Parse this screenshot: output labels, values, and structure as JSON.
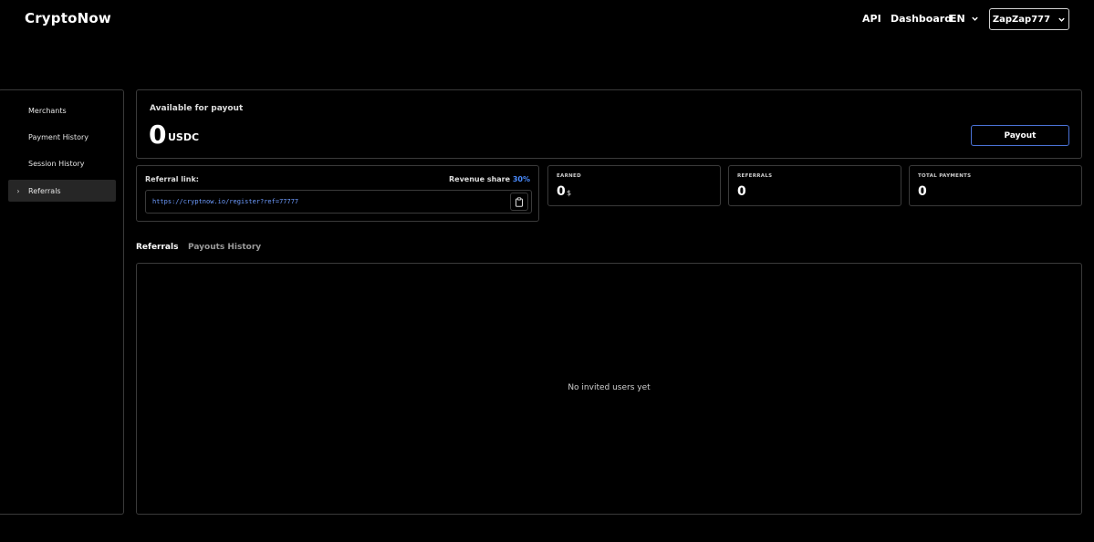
{
  "header": {
    "logo": "CryptoNow",
    "nav_api": "API",
    "nav_dashboard": "Dashboard",
    "lang": "EN",
    "user": "ZapZap777"
  },
  "sidebar": {
    "items": [
      {
        "label": "Merchants"
      },
      {
        "label": "Payment History"
      },
      {
        "label": "Session History"
      },
      {
        "label": "Referrals",
        "active": true
      }
    ]
  },
  "payout": {
    "label": "Available for payout",
    "amount": "0",
    "currency": "USDC",
    "button": "Payout"
  },
  "referral": {
    "label": "Referral link:",
    "revenue_label": "Revenue share",
    "revenue_value": "30%",
    "link": "https://cryptnow.io/register?ref=77777"
  },
  "stats": {
    "earned": {
      "label": "EARNED",
      "value": "0",
      "unit": "$"
    },
    "referrals": {
      "label": "REFERRALS",
      "value": "0"
    },
    "total_payments": {
      "label": "TOTAL PAYMENTS",
      "value": "0"
    }
  },
  "tabs": {
    "referrals": "Referrals",
    "payouts_history": "Payouts History"
  },
  "list": {
    "empty_text": "No invited users yet"
  },
  "colors": {
    "accent": "#4a8cff",
    "button_border": "#4a72d6",
    "card_border": "#3a3a3a"
  }
}
